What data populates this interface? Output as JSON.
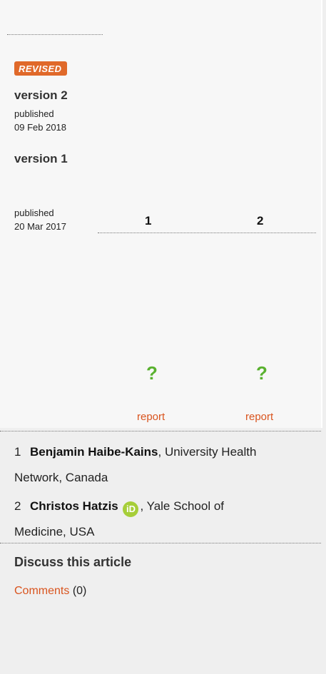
{
  "versions": {
    "badge": "REVISED",
    "v2": {
      "label": "version 2",
      "published_label": "published",
      "date": "09 Feb 2018"
    },
    "v1": {
      "label": "version 1",
      "published_label": "published",
      "date": "20 Mar 2017"
    }
  },
  "reviewers_grid": {
    "columns": [
      "1",
      "2"
    ],
    "reports": [
      {
        "status_icon": "question-mark-icon",
        "status_glyph": "?",
        "link": "report"
      },
      {
        "status_icon": "question-mark-icon",
        "status_glyph": "?",
        "link": "report"
      }
    ]
  },
  "reviewers": [
    {
      "num": "1",
      "name": "Benjamin Haibe-Kains",
      "affiliation_line1": ", University Health",
      "affiliation_line2": "Network, Canada"
    },
    {
      "num": "2",
      "name": "Christos Hatzis",
      "orcid_text": "iD",
      "affiliation_line1": ", Yale School of",
      "affiliation_line2": "Medicine, USA"
    }
  ],
  "discussion": {
    "title": "Discuss this article",
    "comments_link": "Comments",
    "comments_count": "(0)"
  },
  "colors": {
    "badge_bg": "#e0692a",
    "link": "#d9541e",
    "status_green": "#59b12f",
    "orcid_green": "#a6ce39"
  }
}
